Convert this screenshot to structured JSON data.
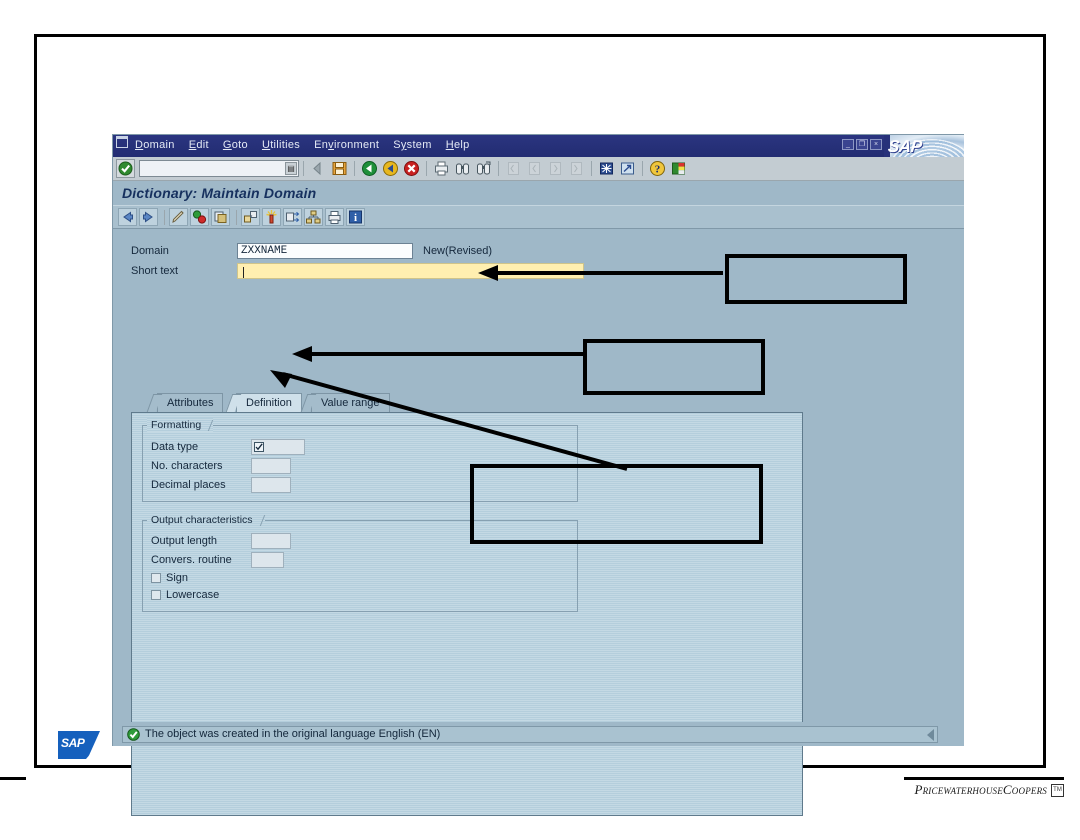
{
  "window": {
    "menu_items": [
      {
        "label": "Domain",
        "accel": "D"
      },
      {
        "label": "Edit",
        "accel": "E"
      },
      {
        "label": "Goto",
        "accel": "G"
      },
      {
        "label": "Utilities",
        "accel": "U"
      },
      {
        "label": "Environment",
        "accel": "v"
      },
      {
        "label": "System",
        "accel": "y"
      },
      {
        "label": "Help",
        "accel": "H"
      }
    ],
    "controls": {
      "minimize": "_",
      "restore": "❐",
      "close": "×"
    },
    "brand": "SAP",
    "screen_title": "Dictionary: Maintain Domain"
  },
  "toolbar": {
    "ok_icon": "enter-check-icon",
    "command_value": "",
    "command_placeholder": "",
    "dropdown_icon": "command-history-icon",
    "buttons": [
      {
        "name": "save-button",
        "icon": "save-icon",
        "enabled": true
      },
      {
        "name": "back-button",
        "icon": "back-green-arrow-icon",
        "enabled": true
      },
      {
        "name": "exit-button",
        "icon": "exit-yellow-arrow-icon",
        "enabled": true
      },
      {
        "name": "cancel-button",
        "icon": "cancel-red-x-icon",
        "enabled": true
      },
      {
        "name": "print-button",
        "icon": "print-icon",
        "enabled": true
      },
      {
        "name": "find-button",
        "icon": "find-binoculars-icon",
        "enabled": true
      },
      {
        "name": "find-next-button",
        "icon": "find-next-binoculars-icon",
        "enabled": true
      },
      {
        "name": "first-page-button",
        "icon": "first-page-icon",
        "enabled": false
      },
      {
        "name": "previous-page-button",
        "icon": "previous-page-icon",
        "enabled": false
      },
      {
        "name": "next-page-button",
        "icon": "next-page-icon",
        "enabled": false
      },
      {
        "name": "last-page-button",
        "icon": "last-page-icon",
        "enabled": false
      },
      {
        "name": "create-session-button",
        "icon": "create-session-icon",
        "enabled": true
      },
      {
        "name": "create-shortcut-button",
        "icon": "create-shortcut-icon",
        "enabled": true
      },
      {
        "name": "help-button",
        "icon": "help-question-icon",
        "enabled": true
      },
      {
        "name": "customize-button",
        "icon": "customize-local-layout-icon",
        "enabled": true
      }
    ]
  },
  "app_toolbar": {
    "buttons": [
      {
        "name": "display-previous-button",
        "icon": "left-blue-arrow-icon"
      },
      {
        "name": "display-next-button",
        "icon": "right-blue-arrow-icon"
      },
      {
        "name": "display-change-button",
        "icon": "pencil-icon"
      },
      {
        "name": "activate-button",
        "icon": "activate-icon"
      },
      {
        "name": "other-object-button",
        "icon": "other-object-icon"
      },
      {
        "name": "where-used-list-button",
        "icon": "where-used-icon"
      },
      {
        "name": "generate-button",
        "icon": "generate-sparkle-icon"
      },
      {
        "name": "expand-button",
        "icon": "expand-arrows-icon"
      },
      {
        "name": "hierarchy-button",
        "icon": "hierarchy-icon"
      },
      {
        "name": "print-preview-button",
        "icon": "print-preview-icon"
      },
      {
        "name": "information-button",
        "icon": "information-icon"
      }
    ]
  },
  "form": {
    "domain_label": "Domain",
    "domain_value": "ZXXNAME",
    "status_text": "New(Revised)",
    "short_text_label": "Short text",
    "short_text_value": ""
  },
  "tabs": [
    {
      "label": "Attributes",
      "active": false
    },
    {
      "label": "Definition",
      "active": true
    },
    {
      "label": "Value range",
      "active": false
    }
  ],
  "formatting": {
    "group_title": "Formatting",
    "fields": [
      {
        "label": "Data type",
        "value": "",
        "has_search_help": true
      },
      {
        "label": "No. characters",
        "value": "",
        "has_search_help": false
      },
      {
        "label": "Decimal places",
        "value": "",
        "has_search_help": false
      }
    ]
  },
  "output_characteristics": {
    "group_title": "Output characteristics",
    "fields": [
      {
        "label": "Output length",
        "value": ""
      },
      {
        "label": "Convers. routine",
        "value": ""
      }
    ],
    "checkboxes": [
      {
        "label": "Sign",
        "checked": false
      },
      {
        "label": "Lowercase",
        "checked": false
      }
    ]
  },
  "status_bar": {
    "icon": "success-check-icon",
    "message": "The object was created in the original language English (EN)",
    "resize_icon": "resize-grip-icon"
  },
  "annotations": [
    {
      "name": "callout-short-text",
      "text": ""
    },
    {
      "name": "callout-data-type",
      "text": ""
    },
    {
      "name": "callout-decimal-places",
      "text": ""
    }
  ],
  "footer": {
    "sap_logo": "SAP",
    "pwc_logo": "PricewaterhouseCoopers",
    "pwc_tm": "TM"
  },
  "colors": {
    "sap_blue": "#27317a",
    "window_bg": "#9fb8c8",
    "panel_bg": "#b4cedc",
    "yellow_field": "#ffefb0",
    "accent": "#16305e"
  }
}
